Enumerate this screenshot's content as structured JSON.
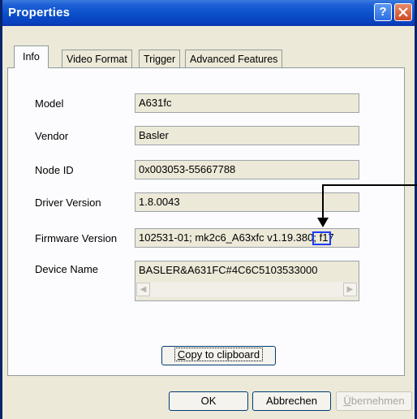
{
  "window": {
    "title": "Properties"
  },
  "titlebar": {
    "help_label": "?"
  },
  "tabs": [
    {
      "label": "Info",
      "active": true
    },
    {
      "label": "Video Format",
      "active": false
    },
    {
      "label": "Trigger",
      "active": false
    },
    {
      "label": "Advanced Features",
      "active": false
    }
  ],
  "fields": {
    "model": {
      "label": "Model",
      "value": "A631fc"
    },
    "vendor": {
      "label": "Vendor",
      "value": "Basler"
    },
    "node_id": {
      "label": "Node ID",
      "value": "0x003053-55667788"
    },
    "driver_version": {
      "label": "Driver Version",
      "value": "1.8.0043"
    },
    "firmware_version": {
      "label": "Firmware Version",
      "value": "102531-01; mk2c6_A63xfc v1.19.380; f17"
    },
    "device_name": {
      "label": "Device Name",
      "value": "BASLER&A631FC#4C6C5103533000"
    }
  },
  "copy_button": {
    "prefix": "",
    "accel": "C",
    "suffix": "opy to clipboard"
  },
  "buttons": {
    "ok": "OK",
    "cancel": "Abbrechen",
    "apply_accel": "Ü",
    "apply_rest": "bernehmen"
  },
  "colors": {
    "titlebar": "#0a4fc9",
    "highlight_box": "#1a3cff",
    "dialog": "#ece9d8"
  },
  "icons": {
    "help": "help-icon",
    "close": "close-icon",
    "scroll_left": "chevron-left-icon",
    "scroll_right": "chevron-right-icon",
    "callout": "arrow-down-icon"
  }
}
